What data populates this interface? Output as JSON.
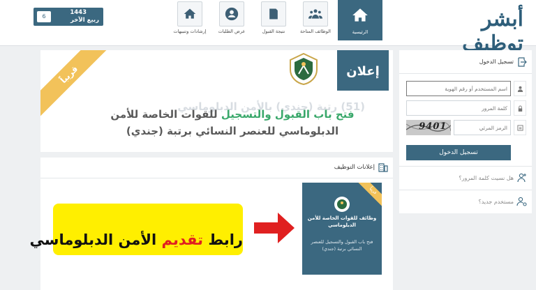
{
  "header": {
    "logo_text": "أبشر توظيف",
    "date": {
      "day": "6",
      "year": "1443",
      "month": "ربيع الآخر"
    },
    "nav": [
      {
        "label": "الرئيسية",
        "icon": "home-icon",
        "active": true
      },
      {
        "label": "الوظائف المتاحة",
        "icon": "group-icon",
        "active": false
      },
      {
        "label": "نتيجة القبول",
        "icon": "result-icon",
        "active": false
      },
      {
        "label": "عرض الطلبات",
        "icon": "user-icon",
        "active": false
      },
      {
        "label": "إرشادات وتنبيهات",
        "icon": "home-icon",
        "active": false
      }
    ]
  },
  "announcement": {
    "ribbon": "قريباً",
    "badge": "إعلان",
    "ghost_text": "(51) رتبة (جندي) بالأمن الدبلوماسي",
    "title_part1": "فتح باب القبول والتسجيل",
    "title_part2": "للقوات الخاصة للأمن الدبلوماسي للعنصر النسائي برتبة (جندي)"
  },
  "jobs": {
    "title": "إعلانات التوظيف",
    "card": {
      "ribbon": "قريباً",
      "title": "وظائف للقوات الخاصة للأمن الدبلوماسي",
      "desc": "فتح باب القبول والتسجيل للعنصر النسائي برتبة (جندي)"
    }
  },
  "overlay": {
    "text_part1": "رابط",
    "text_red": "تقديم",
    "text_part2": "الأمن الدبلوماسي"
  },
  "login": {
    "title": "تسجيل الدخول",
    "username_placeholder": "اسم المستخدم أو رقم الهوية",
    "password_placeholder": "كلمة المرور",
    "captcha_placeholder": "الرمز المرئي",
    "captcha_text": "9401",
    "button": "تسجيل الدخول",
    "forgot": "هل نسيت كلمة المرور؟",
    "new_user": "مستخدم جديد؟"
  },
  "colors": {
    "primary": "#3b6880",
    "ribbon": "#f2c25a",
    "highlight": "#ffef00",
    "accent_red": "#e02020",
    "green": "#3aa86b"
  }
}
